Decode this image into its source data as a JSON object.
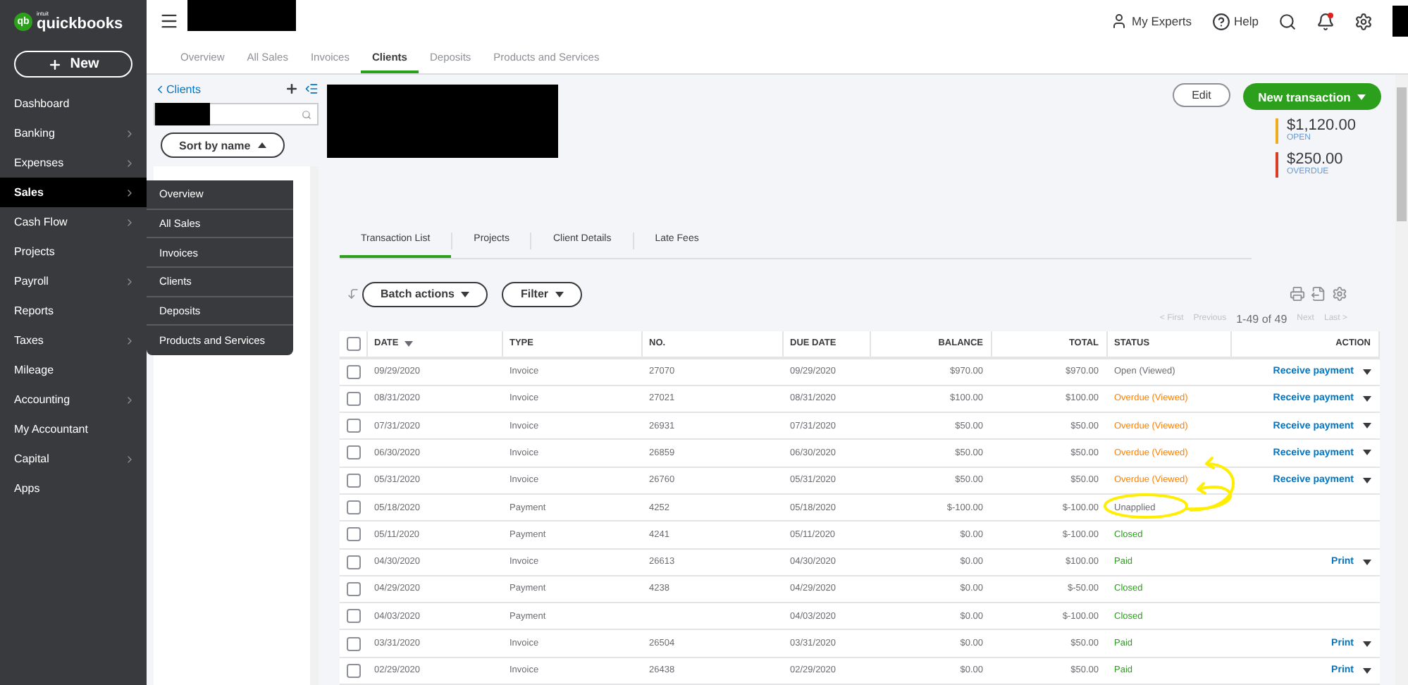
{
  "app": {
    "logo_mark": "qb",
    "logo_small": "intuit",
    "logo": "quickbooks",
    "new_button": "New"
  },
  "sidebar": {
    "items": [
      {
        "label": "Dashboard",
        "has_submenu": false,
        "selected": false
      },
      {
        "label": "Banking",
        "has_submenu": true,
        "selected": false
      },
      {
        "label": "Expenses",
        "has_submenu": true,
        "selected": false
      },
      {
        "label": "Sales",
        "has_submenu": true,
        "selected": true
      },
      {
        "label": "Cash Flow",
        "has_submenu": true,
        "selected": false
      },
      {
        "label": "Projects",
        "has_submenu": false,
        "selected": false
      },
      {
        "label": "Payroll",
        "has_submenu": true,
        "selected": false
      },
      {
        "label": "Reports",
        "has_submenu": false,
        "selected": false
      },
      {
        "label": "Taxes",
        "has_submenu": true,
        "selected": false
      },
      {
        "label": "Mileage",
        "has_submenu": false,
        "selected": false
      },
      {
        "label": "Accounting",
        "has_submenu": true,
        "selected": false
      },
      {
        "label": "My Accountant",
        "has_submenu": false,
        "selected": false
      },
      {
        "label": "Capital",
        "has_submenu": true,
        "selected": false
      },
      {
        "label": "Apps",
        "has_submenu": false,
        "selected": false
      }
    ]
  },
  "flyout_menu": {
    "items": [
      "Overview",
      "All Sales",
      "Invoices",
      "Clients",
      "Deposits",
      "Products and Services"
    ]
  },
  "top_bar": {
    "links": [
      {
        "kind": "experts",
        "label": "My Experts"
      },
      {
        "kind": "help",
        "label": "Help"
      }
    ],
    "notifications_unread": true
  },
  "sub_tabs": [
    {
      "label": "Overview",
      "selected": false
    },
    {
      "label": "All Sales",
      "selected": false
    },
    {
      "label": "Invoices",
      "selected": false
    },
    {
      "label": "Clients",
      "selected": true
    },
    {
      "label": "Deposits",
      "selected": false
    },
    {
      "label": "Products and Services",
      "selected": false
    }
  ],
  "client_panel": {
    "back_link": "Clients",
    "sort_button": "Sort by name"
  },
  "customer": {
    "edit_button": "Edit",
    "new_transaction_button": "New transaction",
    "summary": [
      {
        "amount": "$1,120.00",
        "label": "OPEN",
        "color": "#f0ac1e"
      },
      {
        "amount": "$250.00",
        "label": "OVERDUE",
        "color": "#d93d25"
      }
    ]
  },
  "detail_tabs": [
    {
      "label": "Transaction List",
      "selected": true
    },
    {
      "label": "Projects",
      "selected": false
    },
    {
      "label": "Client Details",
      "selected": false
    },
    {
      "label": "Late Fees",
      "selected": false
    }
  ],
  "toolbar": {
    "batch_button": "Batch actions",
    "filter_button": "Filter"
  },
  "pagination": {
    "first": "< First",
    "previous": "Previous",
    "range": "1-49 of 49",
    "next": "Next",
    "last": "Last >"
  },
  "table": {
    "all_checked": false,
    "columns": [
      {
        "label": "DATE",
        "kind": "text",
        "sorted": true
      },
      {
        "label": "TYPE",
        "kind": "text",
        "sorted": false
      },
      {
        "label": "NO.",
        "kind": "text",
        "sorted": false
      },
      {
        "label": "DUE DATE",
        "kind": "text",
        "sorted": false
      },
      {
        "label": "BALANCE",
        "kind": "amount",
        "sorted": false
      },
      {
        "label": "TOTAL",
        "kind": "amount",
        "sorted": false
      },
      {
        "label": "STATUS",
        "kind": "text",
        "sorted": false
      },
      {
        "label": "ACTION",
        "kind": "amount",
        "sorted": false
      }
    ],
    "rows": [
      {
        "checked": false,
        "cells": [
          "09/29/2020",
          "Invoice",
          "27070",
          "09/29/2020",
          "$970.00",
          "$970.00"
        ],
        "status": {
          "text": "Open (Viewed)",
          "color": "#6b6c72"
        },
        "action": "Receive payment"
      },
      {
        "checked": false,
        "cells": [
          "08/31/2020",
          "Invoice",
          "27021",
          "08/31/2020",
          "$100.00",
          "$100.00"
        ],
        "status": {
          "text": "Overdue (Viewed)",
          "color": "#ff8000"
        },
        "action": "Receive payment"
      },
      {
        "checked": false,
        "cells": [
          "07/31/2020",
          "Invoice",
          "26931",
          "07/31/2020",
          "$50.00",
          "$50.00"
        ],
        "status": {
          "text": "Overdue (Viewed)",
          "color": "#ff8000"
        },
        "action": "Receive payment"
      },
      {
        "checked": false,
        "cells": [
          "06/30/2020",
          "Invoice",
          "26859",
          "06/30/2020",
          "$50.00",
          "$50.00"
        ],
        "status": {
          "text": "Overdue (Viewed)",
          "color": "#ff8000"
        },
        "action": "Receive payment"
      },
      {
        "checked": false,
        "cells": [
          "05/31/2020",
          "Invoice",
          "26760",
          "05/31/2020",
          "$50.00",
          "$50.00"
        ],
        "status": {
          "text": "Overdue (Viewed)",
          "color": "#ff8000"
        },
        "action": "Receive payment"
      },
      {
        "checked": false,
        "cells": [
          "05/18/2020",
          "Payment",
          "4252",
          "05/18/2020",
          "$-100.00",
          "$-100.00"
        ],
        "status": {
          "text": "Unapplied",
          "color": "#6b6c72"
        }
      },
      {
        "checked": false,
        "cells": [
          "05/11/2020",
          "Payment",
          "4241",
          "05/11/2020",
          "$0.00",
          "$-100.00"
        ],
        "status": {
          "text": "Closed",
          "color": "#2ca01c"
        }
      },
      {
        "checked": false,
        "cells": [
          "04/30/2020",
          "Invoice",
          "26613",
          "04/30/2020",
          "$0.00",
          "$100.00"
        ],
        "status": {
          "text": "Paid",
          "color": "#2ca01c"
        },
        "action": "Print"
      },
      {
        "checked": false,
        "cells": [
          "04/29/2020",
          "Payment",
          "4238",
          "04/29/2020",
          "$0.00",
          "$-50.00"
        ],
        "status": {
          "text": "Closed",
          "color": "#2ca01c"
        }
      },
      {
        "checked": false,
        "cells": [
          "04/03/2020",
          "Payment",
          null,
          "04/03/2020",
          "$0.00",
          "$-100.00"
        ],
        "status": {
          "text": "Closed",
          "color": "#2ca01c"
        }
      },
      {
        "checked": false,
        "cells": [
          "03/31/2020",
          "Invoice",
          "26504",
          "03/31/2020",
          "$0.00",
          "$50.00"
        ],
        "status": {
          "text": "Paid",
          "color": "#2ca01c"
        },
        "action": "Print"
      },
      {
        "checked": false,
        "cells": [
          "02/29/2020",
          "Invoice",
          "26438",
          "02/29/2020",
          "$0.00",
          "$50.00"
        ],
        "status": {
          "text": "Paid",
          "color": "#2ca01c"
        },
        "action": "Print"
      }
    ]
  }
}
